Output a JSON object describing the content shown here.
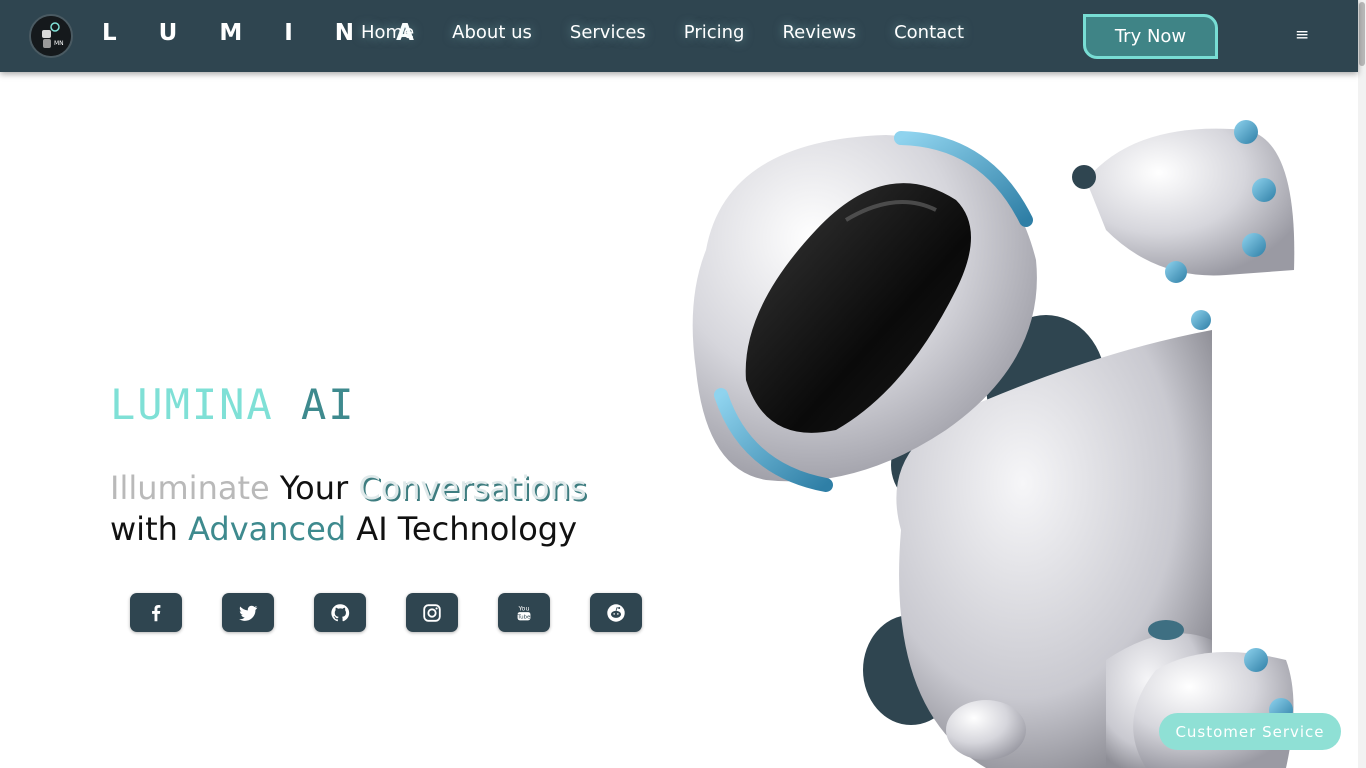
{
  "navbar": {
    "brand": "L U M I N A",
    "links": [
      "Home",
      "About us",
      "Services",
      "Pricing",
      "Reviews",
      "Contact"
    ],
    "cta_label": "Try Now",
    "menu_icon": "≡",
    "logo_icon": "robot-logo-icon"
  },
  "hero": {
    "title_part1": "LUMINA",
    "title_part2": "AI",
    "tagline": {
      "w1": "Illuminate",
      "w2": "Your",
      "w3": "Conversations",
      "w4": "with",
      "w5": "Advanced",
      "w6": "AI Technology"
    }
  },
  "socials": [
    "facebook-icon",
    "twitter-icon",
    "github-icon",
    "instagram-icon",
    "youtube-icon",
    "reddit-icon"
  ],
  "customer_service_label": "Customer Service",
  "colors": {
    "nav_bg": "#2f4550",
    "accent_light": "#7fe0d6",
    "accent_dark": "#3e8a8e",
    "button_bg": "#3f8486",
    "customer_service_bg": "#8fe0d5"
  }
}
